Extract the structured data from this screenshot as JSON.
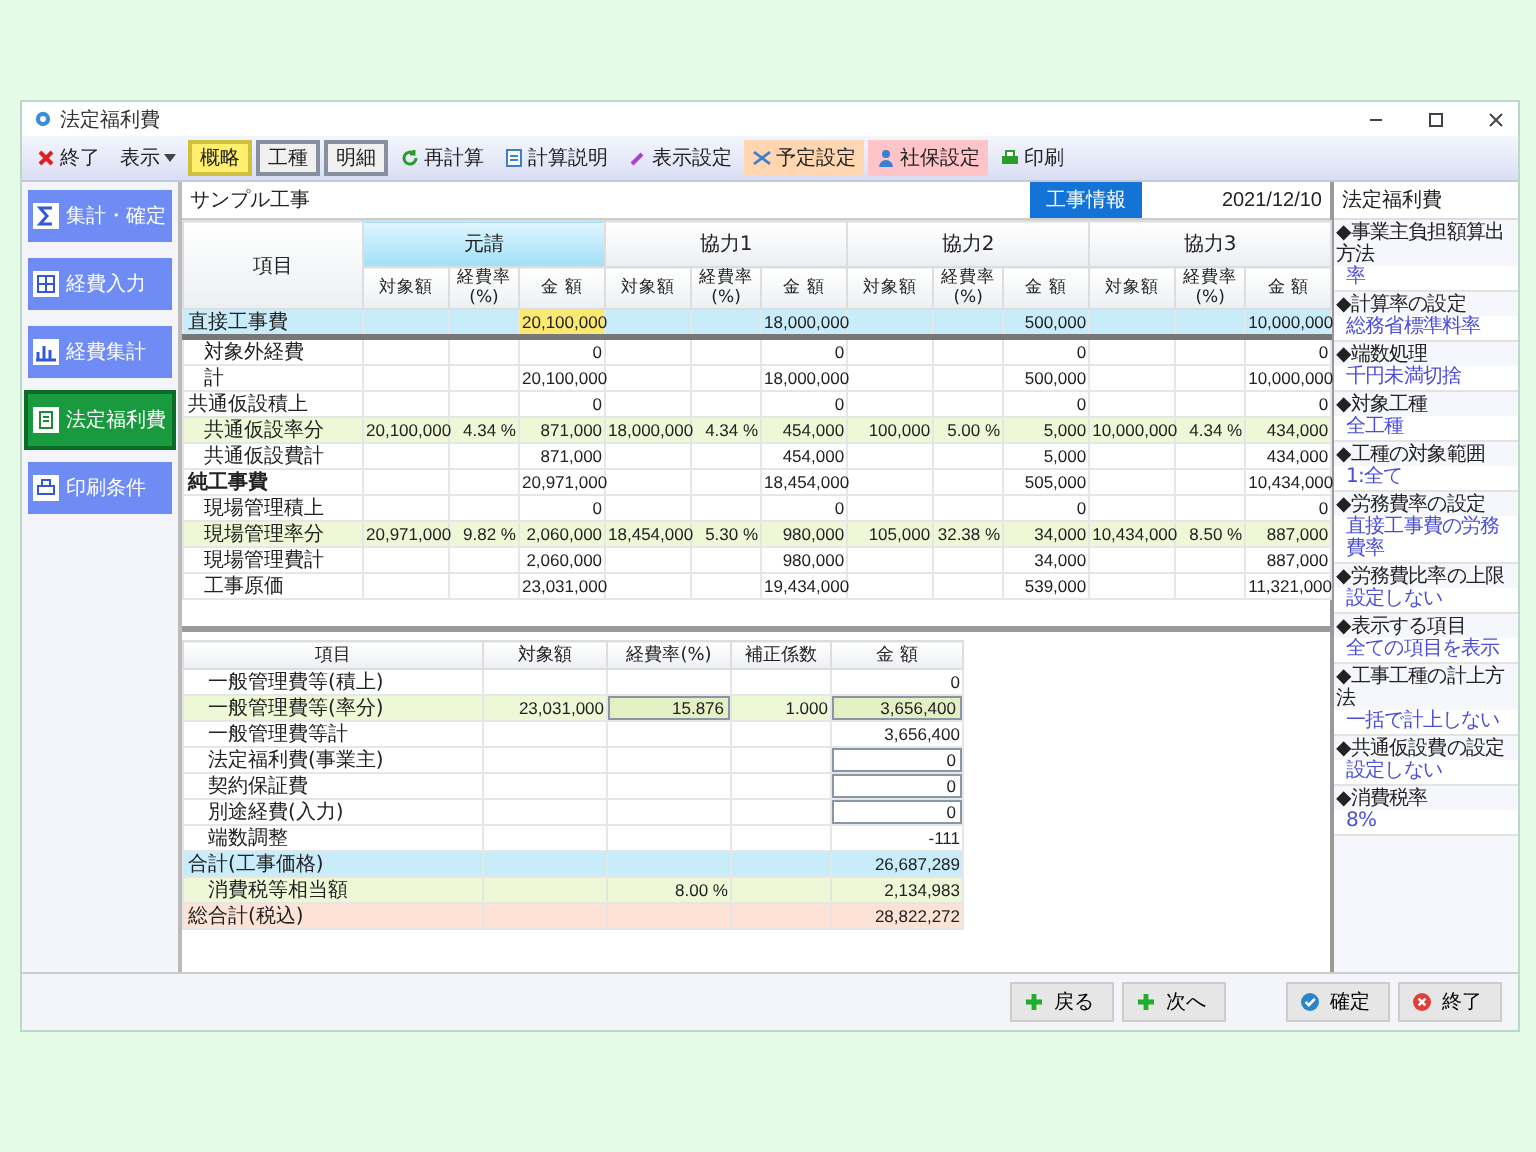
{
  "window": {
    "title": "法定福利費"
  },
  "toolbar": [
    {
      "kind": "button",
      "label": "終了"
    },
    {
      "kind": "menu",
      "label": "表示"
    },
    {
      "kind": "toggle",
      "label": "概略",
      "selected": true
    },
    {
      "kind": "toggle",
      "label": "工種",
      "selected": false
    },
    {
      "kind": "toggle",
      "label": "明細",
      "selected": false
    },
    {
      "kind": "button",
      "label": "再計算"
    },
    {
      "kind": "button",
      "label": "計算説明"
    },
    {
      "kind": "button",
      "label": "表示設定"
    },
    {
      "kind": "button",
      "label": "予定設定",
      "color": "#ffd6b0"
    },
    {
      "kind": "button",
      "label": "社保設定",
      "color": "#ffc4c8"
    },
    {
      "kind": "button",
      "label": "印刷"
    }
  ],
  "nav": [
    {
      "label": "集計・確定",
      "selected": false
    },
    {
      "label": "経費入力",
      "selected": false
    },
    {
      "label": "経費集計",
      "selected": false
    },
    {
      "label": "法定福利費",
      "selected": true
    },
    {
      "label": "印刷条件",
      "selected": false
    }
  ],
  "header": {
    "project": "サンプル工事",
    "info_button": "工事情報",
    "date": "2021/12/10"
  },
  "top_table": {
    "item_heading": "項目",
    "groups": [
      {
        "name": "元請",
        "selected": true,
        "columns": [
          "対象額",
          "経費率(%)",
          "金 額"
        ]
      },
      {
        "name": "協力1",
        "selected": false,
        "columns": [
          "対象額",
          "経費率(%)",
          "金 額"
        ]
      },
      {
        "name": "協力2",
        "selected": false,
        "columns": [
          "対象額",
          "経費率(%)",
          "金 額"
        ]
      },
      {
        "name": "協力3",
        "selected": false,
        "columns": [
          "対象額",
          "経費率(%)",
          "金 額"
        ]
      }
    ],
    "rows": [
      {
        "kind": "base",
        "label": "直接工事費",
        "cells": [
          {
            "amount": "20,100,000",
            "selected": true
          },
          {
            "amount": "18,000,000",
            "selected": false
          },
          {
            "amount": "500,000",
            "selected": false
          },
          {
            "amount": "10,000,000",
            "selected": false
          }
        ]
      },
      {
        "kind": "item",
        "label": "対象外経費",
        "cells": [
          {
            "amount": "0",
            "selected": false
          },
          {
            "amount": "0",
            "selected": false
          },
          {
            "amount": "0",
            "selected": false
          },
          {
            "amount": "0",
            "selected": false
          }
        ]
      },
      {
        "kind": "item",
        "label": "計",
        "cells": [
          {
            "amount": "20,100,000",
            "selected": false
          },
          {
            "amount": "18,000,000",
            "selected": false
          },
          {
            "amount": "500,000",
            "selected": false
          },
          {
            "amount": "10,000,000",
            "selected": false
          }
        ]
      },
      {
        "kind": "section",
        "label": "共通仮設積上",
        "cells": [
          {
            "amount": "0",
            "selected": false
          },
          {
            "amount": "0",
            "selected": false
          },
          {
            "amount": "0",
            "selected": false
          },
          {
            "amount": "0",
            "selected": false
          }
        ]
      },
      {
        "kind": "rate",
        "label": "共通仮設率分",
        "cells": [
          {
            "base": "20,100,000",
            "rate": "4.34 %",
            "amount": "871,000",
            "selected": false
          },
          {
            "base": "18,000,000",
            "rate": "4.34 %",
            "amount": "454,000",
            "selected": false
          },
          {
            "base": "100,000",
            "rate": "5.00 %",
            "amount": "5,000",
            "selected": false
          },
          {
            "base": "10,000,000",
            "rate": "4.34 %",
            "amount": "434,000",
            "selected": false
          }
        ]
      },
      {
        "kind": "item",
        "label": "共通仮設費計",
        "cells": [
          {
            "amount": "871,000",
            "selected": false
          },
          {
            "amount": "454,000",
            "selected": false
          },
          {
            "amount": "5,000",
            "selected": false
          },
          {
            "amount": "434,000",
            "selected": false
          }
        ]
      },
      {
        "kind": "total",
        "label": "純工事費",
        "cells": [
          {
            "amount": "20,971,000",
            "selected": false
          },
          {
            "amount": "18,454,000",
            "selected": false
          },
          {
            "amount": "505,000",
            "selected": false
          },
          {
            "amount": "10,434,000",
            "selected": false
          }
        ]
      },
      {
        "kind": "item",
        "label": "現場管理積上",
        "cells": [
          {
            "amount": "0",
            "selected": false
          },
          {
            "amount": "0",
            "selected": false
          },
          {
            "amount": "0",
            "selected": false
          },
          {
            "amount": "0",
            "selected": false
          }
        ]
      },
      {
        "kind": "rate",
        "label": "現場管理率分",
        "cells": [
          {
            "base": "20,971,000",
            "rate": "9.82 %",
            "amount": "2,060,000",
            "selected": false
          },
          {
            "base": "18,454,000",
            "rate": "5.30 %",
            "amount": "980,000",
            "selected": false
          },
          {
            "base": "105,000",
            "rate": "32.38 %",
            "amount": "34,000",
            "selected": false
          },
          {
            "base": "10,434,000",
            "rate": "8.50 %",
            "amount": "887,000",
            "selected": false
          }
        ]
      },
      {
        "kind": "item",
        "label": "現場管理費計",
        "cells": [
          {
            "amount": "2,060,000",
            "selected": false
          },
          {
            "amount": "980,000",
            "selected": false
          },
          {
            "amount": "34,000",
            "selected": false
          },
          {
            "amount": "887,000",
            "selected": false
          }
        ]
      },
      {
        "kind": "item",
        "label": "工事原価",
        "cells": [
          {
            "amount": "23,031,000",
            "selected": false
          },
          {
            "amount": "19,434,000",
            "selected": false
          },
          {
            "amount": "539,000",
            "selected": false
          },
          {
            "amount": "11,321,000",
            "selected": false
          }
        ]
      }
    ]
  },
  "bottom_table": {
    "columns": [
      "項目",
      "対象額",
      "経費率(%)",
      "補正係数",
      "金 額"
    ],
    "rows": [
      {
        "kind": "plain",
        "label": "一般管理費等(積上)",
        "amount": "0"
      },
      {
        "kind": "rate",
        "label": "一般管理費等(率分)",
        "base": "23,031,000",
        "rate": "15.876",
        "factor": "1.000",
        "amount": "3,656,400"
      },
      {
        "kind": "plain",
        "label": "一般管理費等計",
        "amount": "3,656,400"
      },
      {
        "kind": "input",
        "label": "法定福利費(事業主)",
        "amount": "0"
      },
      {
        "kind": "input",
        "label": "契約保証費",
        "amount": "0"
      },
      {
        "kind": "input",
        "label": "別途経費(入力)",
        "amount": "0"
      },
      {
        "kind": "plain",
        "label": "端数調整",
        "amount": "-111"
      },
      {
        "kind": "total",
        "label": "合計(工事価格)",
        "amount": "26,687,289"
      },
      {
        "kind": "tax",
        "label": "消費税等相当額",
        "rate": "8.00 %",
        "amount": "2,134,983"
      },
      {
        "kind": "grand",
        "label": "総合計(税込)",
        "amount": "28,822,272"
      }
    ]
  },
  "side_panel": {
    "title": "法定福利費",
    "sections": [
      {
        "heading": "◆事業主負担額算出方法",
        "value": "率"
      },
      {
        "heading": "◆計算率の設定",
        "value": "総務省標準料率"
      },
      {
        "heading": "◆端数処理",
        "value": "千円未満切捨"
      },
      {
        "heading": "◆対象工種",
        "value": "全工種"
      },
      {
        "heading": "◆工種の対象範囲",
        "value": "1:全て"
      },
      {
        "heading": "◆労務費率の設定",
        "value": "直接工事費の労務費率"
      },
      {
        "heading": "◆労務費比率の上限",
        "value": "設定しない"
      },
      {
        "heading": "◆表示する項目",
        "value": "全ての項目を表示"
      },
      {
        "heading": "◆工事工種の計上方法",
        "value": "一括で計上しない"
      },
      {
        "heading": "◆共通仮設費の設定",
        "value": "設定しない"
      },
      {
        "heading": "◆消費税率",
        "value": "8%"
      }
    ]
  },
  "footer": [
    {
      "label": "戻る"
    },
    {
      "label": "次へ"
    },
    {
      "label": "確定"
    },
    {
      "label": "終了"
    }
  ]
}
